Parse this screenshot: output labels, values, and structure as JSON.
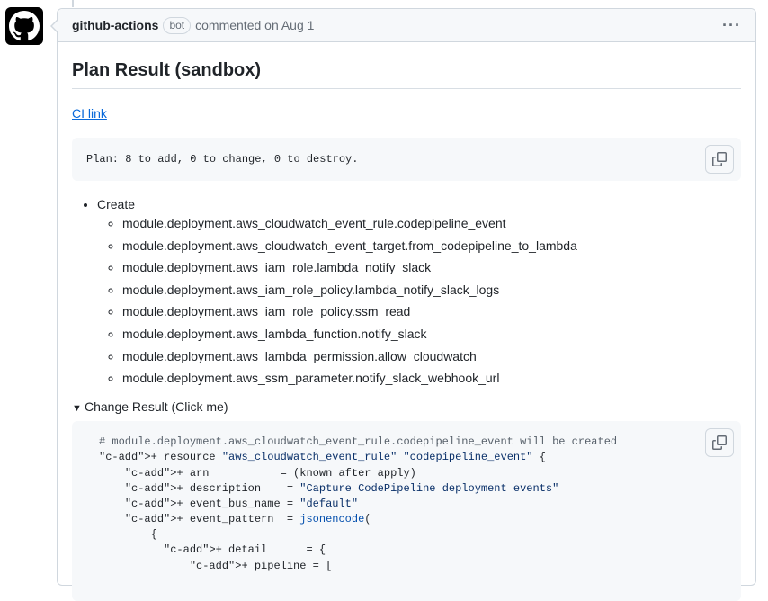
{
  "comment": {
    "author": "github-actions",
    "badge": "bot",
    "meta": "commented on Aug 1",
    "menu_icon": "kebab-horizontal-icon",
    "title": "Plan Result (sandbox)",
    "link_text": "CI link",
    "plan_summary": "Plan: 8 to add, 0 to change, 0 to destroy.",
    "create_label": "Create",
    "resources": [
      "module.deployment.aws_cloudwatch_event_rule.codepipeline_event",
      "module.deployment.aws_cloudwatch_event_target.from_codepipeline_to_lambda",
      "module.deployment.aws_iam_role.lambda_notify_slack",
      "module.deployment.aws_iam_role_policy.lambda_notify_slack_logs",
      "module.deployment.aws_iam_role_policy.ssm_read",
      "module.deployment.aws_lambda_function.notify_slack",
      "module.deployment.aws_lambda_permission.allow_cloudwatch",
      "module.deployment.aws_ssm_parameter.notify_slack_webhook_url"
    ],
    "details_summary": "Change Result (Click me)",
    "code_lines": [
      "# module.deployment.aws_cloudwatch_event_rule.codepipeline_event will be created",
      "+ resource \"aws_cloudwatch_event_rule\" \"codepipeline_event\" {",
      "    + arn           = (known after apply)",
      "    + description    = \"Capture CodePipeline deployment events\"",
      "    + event_bus_name = \"default\"",
      "    + event_pattern  = jsonencode(",
      "        {",
      "          + detail      = {",
      "              + pipeline = ["
    ]
  },
  "colors": {
    "link": "#0969da",
    "diff_add": "#cf222e",
    "string": "#0a3069",
    "comment": "#57606a"
  }
}
